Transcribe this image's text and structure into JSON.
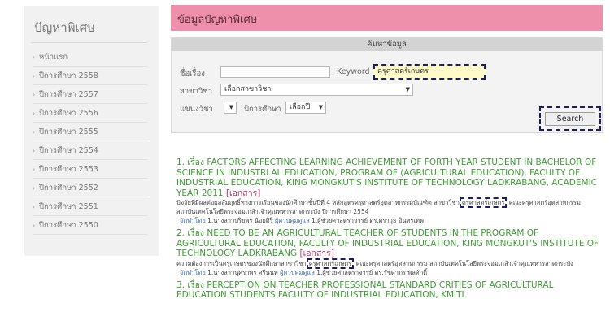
{
  "sidebar": {
    "title": "ปัญหาพิเศษ",
    "items": [
      {
        "label": "หน้าแรก"
      },
      {
        "label": "ปีการศึกษา 2558"
      },
      {
        "label": "ปีการศึกษา 2557"
      },
      {
        "label": "ปีการศึกษา 2556"
      },
      {
        "label": "ปีการศึกษา 2555"
      },
      {
        "label": "ปีการศึกษา 2554"
      },
      {
        "label": "ปีการศึกษา 2553"
      },
      {
        "label": "ปีการศึกษา 2552"
      },
      {
        "label": "ปีการศึกษา 2551"
      },
      {
        "label": "ปีการศึกษา 2550"
      }
    ]
  },
  "header": {
    "title": "ข้อมูลปัญหาพิเศษ"
  },
  "search": {
    "panel_title": "ค้นหาข้อมูล",
    "subject_label": "ชื่อเรื่อง",
    "subject_value": "",
    "keyword_label": "Keyword",
    "keyword_value": "ครุศาสตร์เกษตร",
    "major_label": "สาขาวิชา",
    "major_value": "เลือกสาขาวิชา",
    "category_label": "แขนงวิชา",
    "category_value": "",
    "year_label": "ปีการศึกษา",
    "year_value": "เลือกปี",
    "button_label": "Search"
  },
  "results": [
    {
      "number": "1.",
      "prefix": "เรื่อง",
      "title": "FACTORS AFFECTING LEARNING ACHIEVEMENT OF FORTH YEAR STUDENT IN BACHELOR OF SCIENCE IN INDUSTRLAL EDUCATION, PROGRAM OF (AGRICULTURAL EDUCATION), FACULTY OF INDUSTRIAL EDUCATION, KING MONGKUT'S INSTITUTE OF TECHNOLOGY LADKRABANG, ACADEMIC YEAR 2011",
      "tag": "[เอกสาร]",
      "abstract_before": "ปัจจัยที่มีผลต่อผลสัมฤทธิ์ทางการเรียนของนักศึกษาชั้นปีที่ 4 หลักสูตรครุศาสตร์อุตสาหกรรมบัณฑิต สาขาวิชา",
      "abstract_highlight": "ครุศาสตร์เกษตร",
      "abstract_after": "คณะครุศาสตร์อุตสาหกรรม สถาบันเทคโนโลยีพระจอมเกล้าเจ้าคุณทหารลาดกระบัง ปีการศึกษา 2554",
      "meta_label": "จัดทำโดย",
      "authors": "1.นางสาวปริยพร น้อยศิริ",
      "advisor_label": "ผู้ควบคุมดูแล",
      "advisor": "1.ผู้ช่วยศาสตราจารย์ ดร.ศราวุธ อินทรเทพ"
    },
    {
      "number": "2.",
      "prefix": "เรื่อง",
      "title": "NEED TO BE AN AGRICULTURAL TEACHER OF STUDENTS IN THE PROGRAM OF AGRICULTURAL EDUCATION, FACULTY OF INDUSTRIAL EDUCATION, KING MONGKUT'S INSTITUTE OF TECHNOLOGY LADKRABANG",
      "tag": "[เอกสาร]",
      "abstract_before": "ความต้องการเป็นครูเกษตรของนักศึกษาสาขาวิชา",
      "abstract_highlight": "ครุศาสตร์เกษตร",
      "abstract_after": "คณะครุศาสตร์อุตสาหกรรม สถาบันเทคโนโลยีพระจอมเกล้าเจ้าคุณทหารลาดกระบัง",
      "meta_label": "จัดทำโดย",
      "authors": "1.นางสาวนุศราพร ศรีนนท",
      "advisor_label": "ผู้ควบคุมดูแล",
      "advisor": "1.ผู้ช่วยศาสตราจารย์ ดร.รัชดาภร พลศักดิ์"
    },
    {
      "number": "3.",
      "prefix": "เรื่อง",
      "title": "PERCEPTION ON TEACHER PROFESSIONAL STANDARD CRITIES OF AGRICULTURAL EDUCATION STUDENTS FACULTY OF INDUSTRIAL EDUCATION, KMITL",
      "tag": ""
    }
  ],
  "colors": {
    "header_bg": "#ee8fab",
    "result_title": "#3f9a35",
    "tag": "#c0306a",
    "link": "#3f6fb5",
    "highlight_border": "#1a1a6e"
  }
}
